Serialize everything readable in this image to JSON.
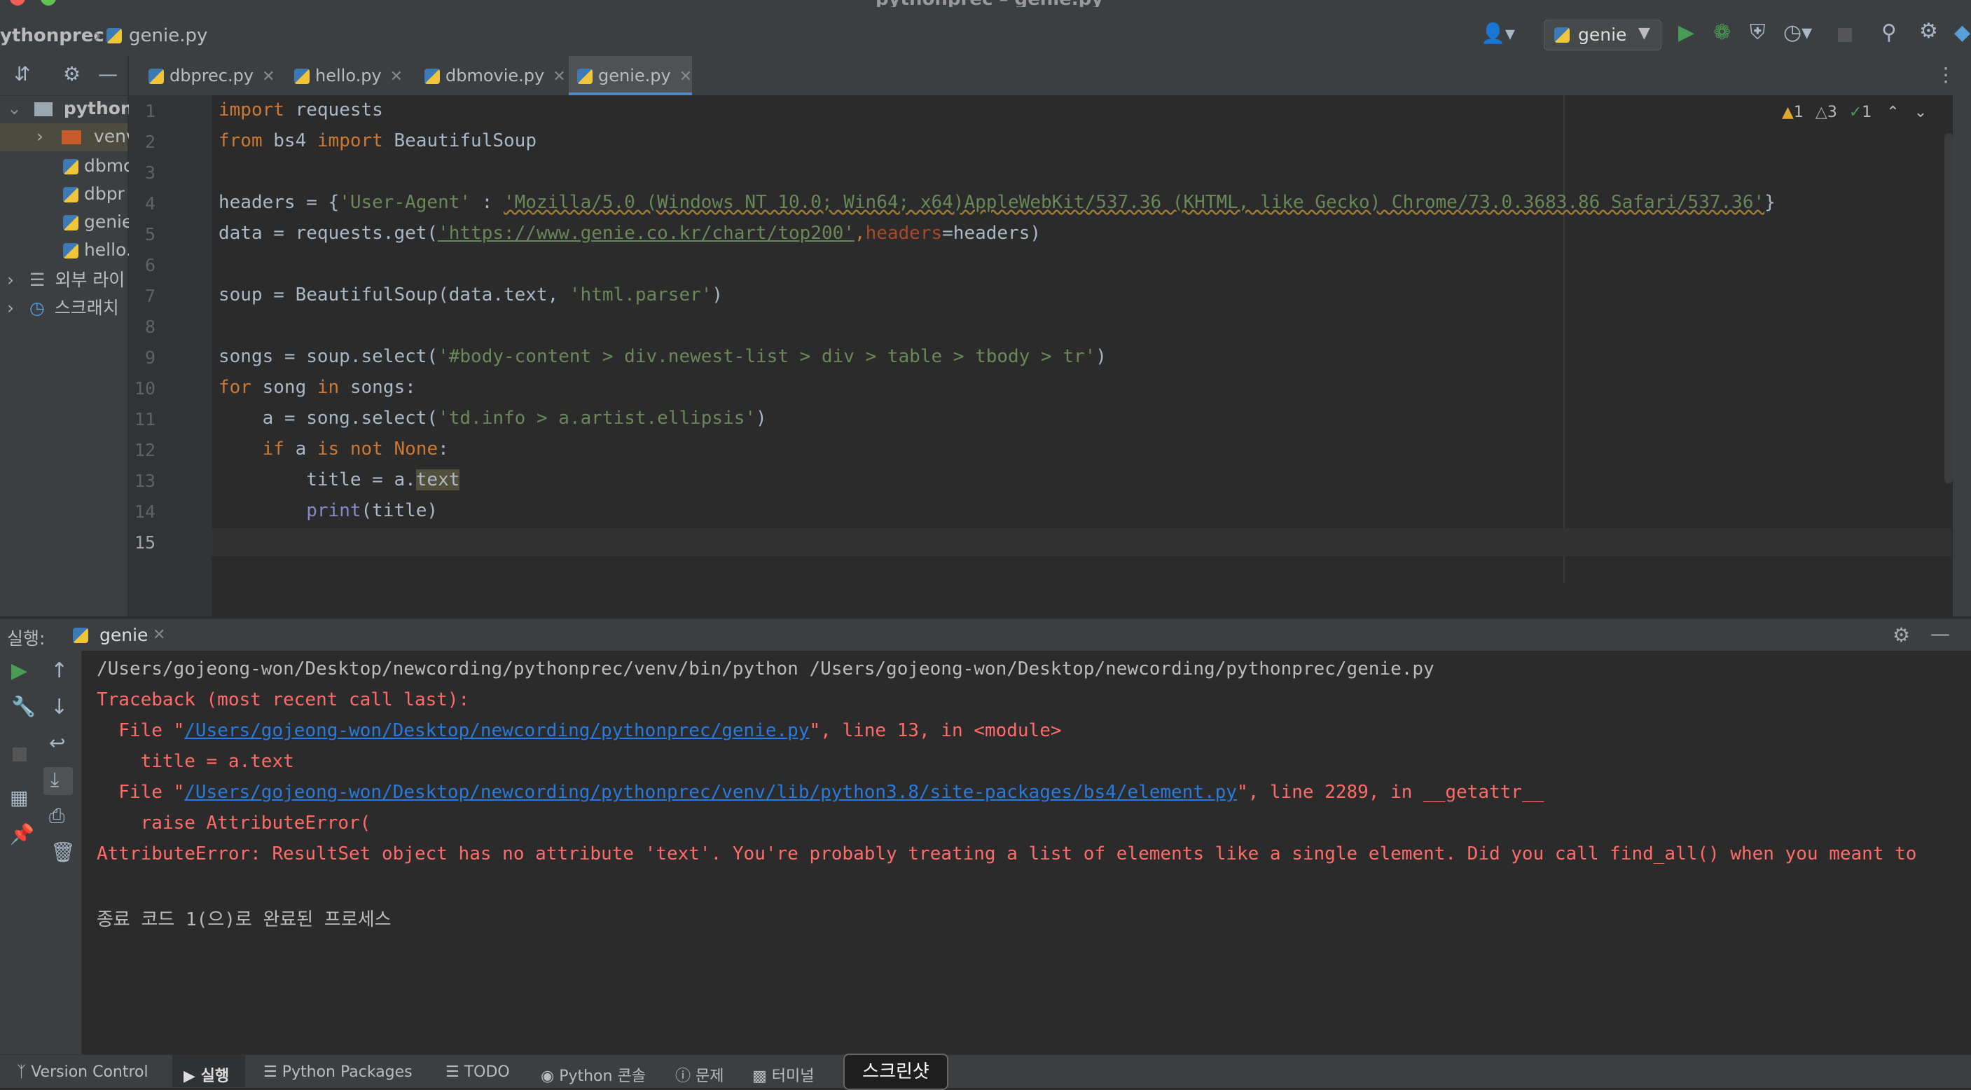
{
  "window": {
    "title": "pythonprec – genie.py"
  },
  "navbar": {
    "project": "ythonprec",
    "file": "genie.py",
    "run_config": "genie"
  },
  "project_tree": {
    "root": "python",
    "items": [
      "venv",
      "dbmc",
      "dbpr",
      "genie",
      "hello."
    ],
    "external_libs": "외부 라이",
    "scratches": "스크래치"
  },
  "tabs": [
    {
      "label": "dbprec.py",
      "active": false
    },
    {
      "label": "hello.py",
      "active": false
    },
    {
      "label": "dbmovie.py",
      "active": false
    },
    {
      "label": "genie.py",
      "active": true
    }
  ],
  "inspections": {
    "warnings": "1",
    "weak_warnings": "3",
    "ok": "1"
  },
  "editor": {
    "line_numbers": [
      "1",
      "2",
      "3",
      "4",
      "5",
      "6",
      "7",
      "8",
      "9",
      "10",
      "11",
      "12",
      "13",
      "14",
      "15"
    ],
    "lines": {
      "l1_kw": "import",
      "l1_rest": " requests",
      "l2_kw1": "from",
      "l2_mod": " bs4 ",
      "l2_kw2": "import",
      "l2_rest": " BeautifulSoup",
      "l4_a": "headers = {",
      "l4_key": "'User-Agent'",
      "l4_colon": " : ",
      "l4_val": "'Mozilla/5.0 (Windows NT 10.0; Win64; x64)AppleWebKit/537.36 (KHTML, like Gecko) Chrome/73.0.3683.86 Safari/537.36'",
      "l4_end": "}",
      "l5_a": "data = requests.get(",
      "l5_url": "'https://www.genie.co.kr/chart/top200'",
      "l5_comma": ",",
      "l5_param": "headers",
      "l5_end": "=headers)",
      "l7_a": "soup = BeautifulSoup(data.text, ",
      "l7_str": "'html.parser'",
      "l7_end": ")",
      "l9_a": "songs = soup.select(",
      "l9_str": "'#body-content > div.newest-list > div > table > tbody > tr'",
      "l9_end": ")",
      "l10_kw1": "for",
      "l10_mid": " song ",
      "l10_kw2": "in",
      "l10_end": " songs:",
      "l11_a": "    a = song.select(",
      "l11_str": "'td.info > a.artist.ellipsis'",
      "l11_end": ")",
      "l12_ind": "    ",
      "l12_kw1": "if",
      "l12_mid": " a ",
      "l12_kw2": "is not None",
      "l12_end": ":",
      "l13_a": "        title = a.",
      "l13_hl": "text",
      "l14_ind": "        ",
      "l14_bi": "print",
      "l14_end": "(title)"
    }
  },
  "run_panel": {
    "label": "실행:",
    "tab": "genie",
    "output": {
      "cmd": "/Users/gojeong-won/Desktop/newcording/pythonprec/venv/bin/python /Users/gojeong-won/Desktop/newcording/pythonprec/genie.py",
      "traceback": "Traceback (most recent call last):",
      "file1_pre": "  File \"",
      "file1_link": "/Users/gojeong-won/Desktop/newcording/pythonprec/genie.py",
      "file1_post": "\", line 13, in <module>",
      "code1": "    title = a.text",
      "file2_pre": "  File \"",
      "file2_link": "/Users/gojeong-won/Desktop/newcording/pythonprec/venv/lib/python3.8/site-packages/bs4/element.py",
      "file2_post": "\", line 2289, in __getattr__",
      "code2": "    raise AttributeError(",
      "error": "AttributeError: ResultSet object has no attribute 'text'. You're probably treating a list of elements like a single element. Did you call find_all() when you meant to",
      "exit": "종료 코드 1(으)로 완료된 프로세스"
    }
  },
  "statusbar": {
    "version_control": "Version Control",
    "run": "실행",
    "python_packages": "Python Packages",
    "todo": "TODO",
    "python_console": "Python 콘솔",
    "problems": "문제",
    "terminal": "터미널",
    "screenshot": "스크린샷"
  },
  "colors": {
    "background": "#2b2b2b",
    "keyword": "#cc7832",
    "string": "#6a8759",
    "error": "#ff6b68",
    "link": "#287bde",
    "run_green": "#499c54"
  }
}
